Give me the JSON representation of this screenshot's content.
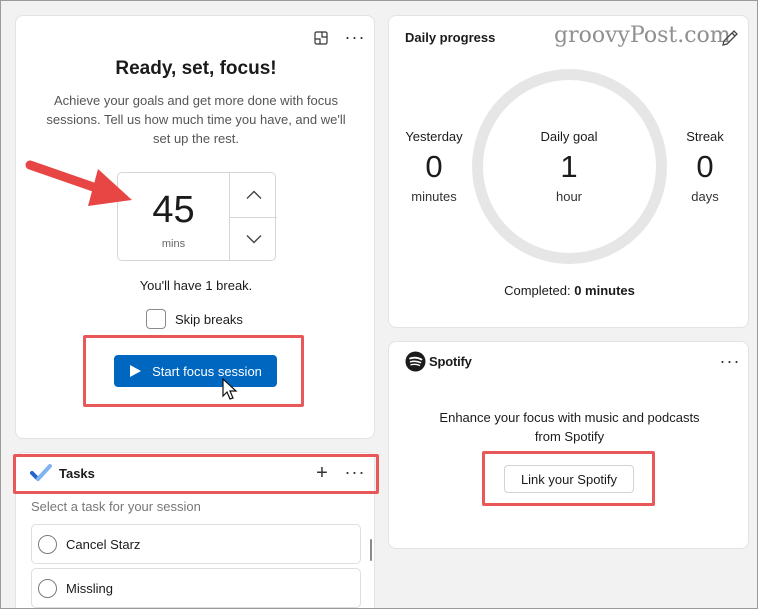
{
  "focus": {
    "title": "Ready, set, focus!",
    "description": "Achieve your goals and get more done with focus sessions. Tell us how much time you have, and we'll set up the rest.",
    "timer_value": "45",
    "timer_unit": "mins",
    "break_text": "You'll have 1 break.",
    "skip_breaks_label": "Skip breaks",
    "start_button_label": "Start focus session"
  },
  "tasks": {
    "title": "Tasks",
    "subtitle": "Select a task for your session",
    "items": [
      {
        "label": "Cancel Starz"
      },
      {
        "label": "Missling"
      }
    ]
  },
  "progress": {
    "title": "Daily progress",
    "watermark": "groovyPost.com",
    "yesterday": {
      "label": "Yesterday",
      "value": "0",
      "unit": "minutes"
    },
    "daily_goal": {
      "label": "Daily goal",
      "value": "1",
      "unit": "hour"
    },
    "streak": {
      "label": "Streak",
      "value": "0",
      "unit": "days"
    },
    "completed_label": "Completed:",
    "completed_value": "0 minutes"
  },
  "spotify": {
    "brand": "Spotify",
    "description": "Enhance your focus with music and podcasts from Spotify",
    "link_button_label": "Link your Spotify"
  },
  "colors": {
    "accent": "#0067c0",
    "highlight": "#e85858",
    "spotify_brand": "#1b1b1b"
  }
}
